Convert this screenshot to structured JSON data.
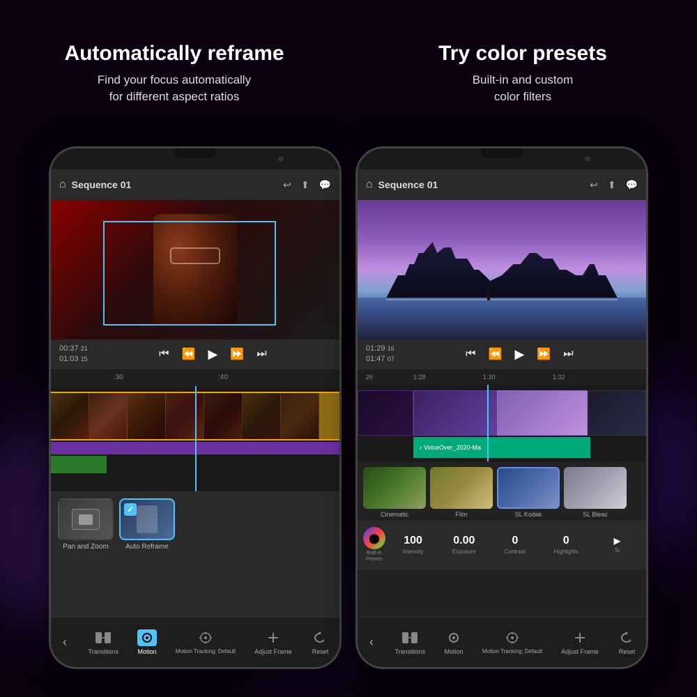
{
  "header": {
    "left_title": "Automatically reframe",
    "left_subtitle": "Find your focus automatically\nfor different aspect ratios",
    "right_title": "Try color presets",
    "right_subtitle": "Built-in and custom\ncolor filters"
  },
  "phone1": {
    "sequence": "Sequence 01",
    "timecode1": "00:37",
    "timecode1_frames": "21",
    "timecode2": "01:03",
    "timecode2_frames": "15",
    "ruler_mark1": ":30",
    "ruler_mark2": ":40",
    "presets": [
      {
        "label": "Pan and Zoom"
      },
      {
        "label": "Auto Reframe"
      }
    ],
    "nav_items": [
      {
        "label": "Transitions",
        "icon": "⊞"
      },
      {
        "label": "Motion",
        "icon": "◎",
        "active": true
      },
      {
        "label": "Motion Tracking: Default",
        "icon": "⌖"
      },
      {
        "label": "Adjust Frame",
        "icon": "+"
      },
      {
        "label": "Reset",
        "icon": "↺"
      }
    ]
  },
  "phone2": {
    "sequence": "Sequence 01",
    "timecode1": "01:29",
    "timecode1_frames": "16",
    "timecode2": "01:47",
    "timecode2_frames": "07",
    "ruler_marks": [
      "26",
      "1:28",
      "1:30",
      "1:32"
    ],
    "voiceover_label": "♪ VoiceOver_2020-Ma",
    "color_presets": [
      {
        "label": "Cinematic"
      },
      {
        "label": "Film"
      },
      {
        "label": "SL Kodak"
      },
      {
        "label": "SL Bleac"
      }
    ],
    "adj_values": [
      {
        "label": "Built-in\nPresets",
        "value": ""
      },
      {
        "label": "Intensity",
        "value": "100"
      },
      {
        "label": "Exposure",
        "value": "0.00"
      },
      {
        "label": "Contrast",
        "value": "0"
      },
      {
        "label": "Highlights",
        "value": "0"
      },
      {
        "label": "Si",
        "value": ""
      }
    ],
    "nav_items": [
      {
        "label": "Transitions",
        "icon": "⊞"
      },
      {
        "label": "Motion",
        "icon": "◎"
      },
      {
        "label": "Motion Tracking: Default",
        "icon": "⌖"
      },
      {
        "label": "Adjust Frame",
        "icon": "+"
      },
      {
        "label": "Reset",
        "icon": "↺"
      }
    ]
  },
  "colors": {
    "accent": "#4fc3f7",
    "bg": "#0a0010",
    "active_nav": "#4fc3f7"
  }
}
